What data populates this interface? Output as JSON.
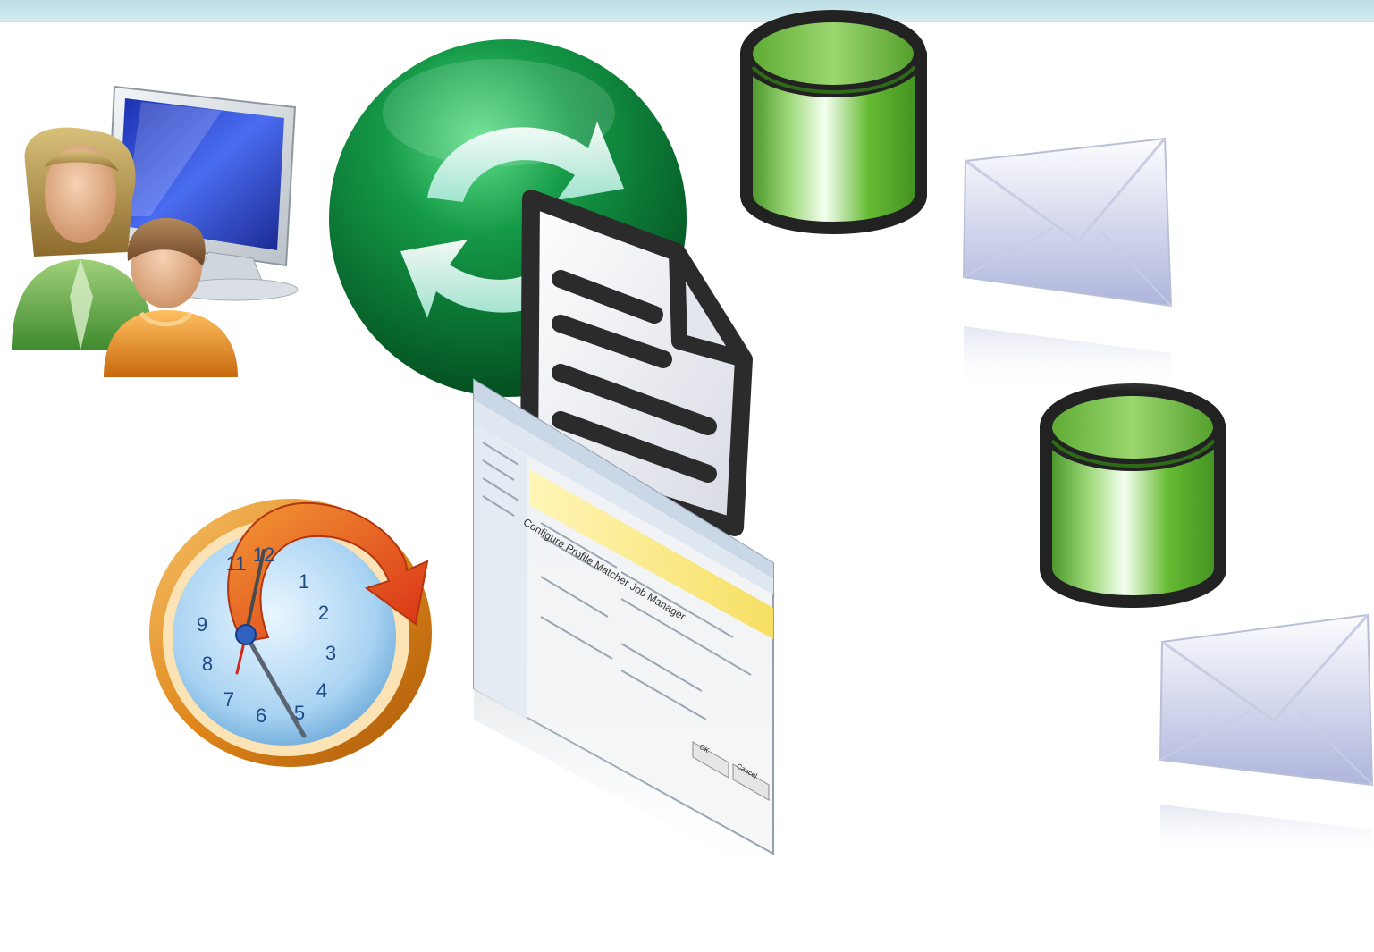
{
  "slide": {
    "icons": {
      "users": "users-computer-icon",
      "sync": "sync-icon",
      "document": "document-icon",
      "clock": "scheduled-clock-icon",
      "database_top": "database-icon",
      "database_bottom": "database-icon",
      "mail_top": "envelope-icon",
      "mail_bottom": "envelope-icon"
    },
    "colors": {
      "header_band": "#c6e3eb",
      "sync_green": "#0b7a36",
      "database_green": "#5fb52d",
      "clock_orange": "#e88a16",
      "clock_arrow": "#e8401a"
    },
    "screenshot": {
      "heading": "Configure Profile Matcher Job Manager",
      "ok_label": "OK",
      "cancel_label": "Cancel"
    },
    "clock_numbers": [
      "12",
      "1",
      "2",
      "3",
      "4",
      "5",
      "6",
      "7",
      "8",
      "9",
      "11"
    ]
  }
}
